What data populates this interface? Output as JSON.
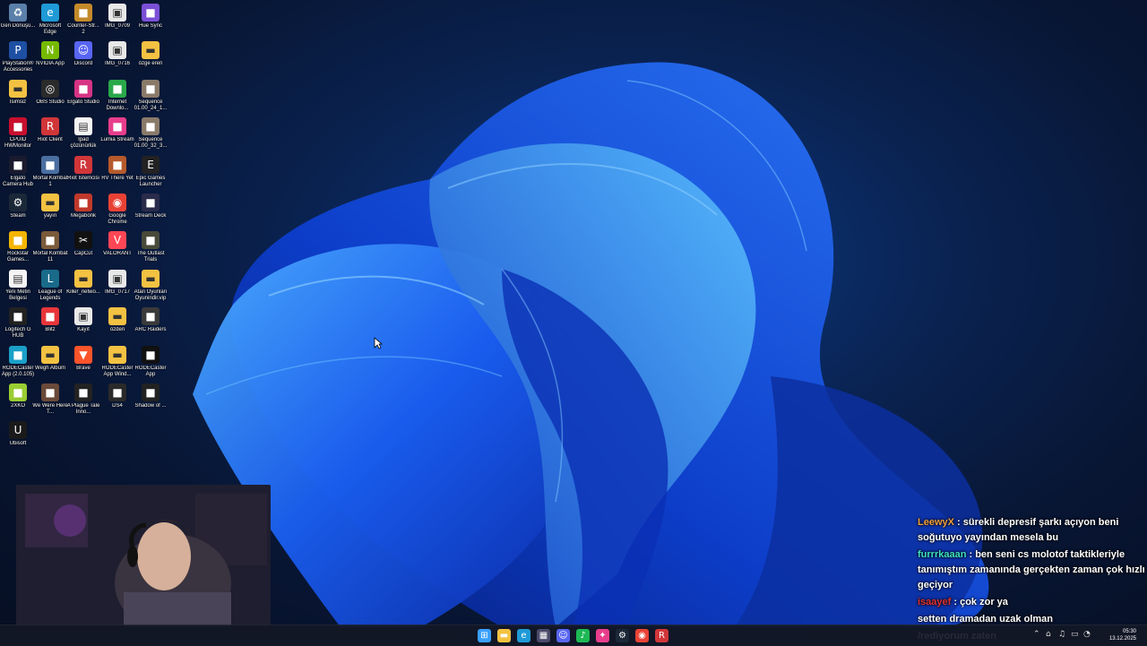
{
  "desktop_icons": [
    {
      "label": "Geri Dönüşü...",
      "icon": "recycle-bin-icon",
      "color": "#5a7fa8"
    },
    {
      "label": "Microsoft Edge",
      "icon": "edge-icon",
      "color": "#1f9ad6"
    },
    {
      "label": "Counter-Str... 2",
      "icon": "cs2-icon",
      "color": "#c48a2a"
    },
    {
      "label": "IMG_0709",
      "icon": "image-file-icon",
      "color": "#e8e8e8"
    },
    {
      "label": "Hue Sync",
      "icon": "hue-sync-icon",
      "color": "#7b4fd6"
    },
    {
      "label": "PlayStation® Accessories",
      "icon": "playstation-icon",
      "color": "#1d4fa3"
    },
    {
      "label": "NVIDIA App",
      "icon": "nvidia-icon",
      "color": "#76b900"
    },
    {
      "label": "Discord",
      "icon": "discord-icon",
      "color": "#5865f2"
    },
    {
      "label": "IMG_0716",
      "icon": "image-file-icon",
      "color": "#e8e8e8"
    },
    {
      "label": "özge eren",
      "icon": "folder-icon",
      "color": "#f3c242"
    },
    {
      "label": "İsimsiz",
      "icon": "folder-icon",
      "color": "#f3c242"
    },
    {
      "label": "OBS Studio",
      "icon": "obs-icon",
      "color": "#2b2b2b"
    },
    {
      "label": "Elgato Studio",
      "icon": "elgato-studio-icon",
      "color": "#d63384"
    },
    {
      "label": "Internet Downlo...",
      "icon": "idm-icon",
      "color": "#2aa84a"
    },
    {
      "label": "Sequence 01.00_24_1...",
      "icon": "video-thumbnail-icon",
      "color": "#8a7a6a"
    },
    {
      "label": "CPUID HWMonitor",
      "icon": "hwmonitor-icon",
      "color": "#c8102e"
    },
    {
      "label": "Riot Client",
      "icon": "riot-icon",
      "color": "#d13639"
    },
    {
      "label": "İpad çözünürlük",
      "icon": "text-file-icon",
      "color": "#f5f5f5"
    },
    {
      "label": "Lumia Stream",
      "icon": "lumia-icon",
      "color": "#e83e8c"
    },
    {
      "label": "Sequence 01.00_32_3...",
      "icon": "video-thumbnail-icon",
      "color": "#8a7a6a"
    },
    {
      "label": "Elgato Camera Hub",
      "icon": "camera-hub-icon",
      "color": "#1a1a2e"
    },
    {
      "label": "Mortal Kombat 1",
      "icon": "mk1-icon",
      "color": "#4a6ea0"
    },
    {
      "label": "Riot İstemcisi",
      "icon": "riot-icon",
      "color": "#d13639"
    },
    {
      "label": "RV There Yet",
      "icon": "rv-game-icon",
      "color": "#b55a2c"
    },
    {
      "label": "Epic Games Launcher",
      "icon": "epic-icon",
      "color": "#222"
    },
    {
      "label": "Steam",
      "icon": "steam-icon",
      "color": "#1b2838"
    },
    {
      "label": "yayın",
      "icon": "folder-icon",
      "color": "#f3c242"
    },
    {
      "label": "Megabonk",
      "icon": "megabonk-icon",
      "color": "#c0392b"
    },
    {
      "label": "Google Chrome",
      "icon": "chrome-icon",
      "color": "#e94235"
    },
    {
      "label": "Stream Deck",
      "icon": "stream-deck-icon",
      "color": "#2b2b4a"
    },
    {
      "label": "Rockstar Games...",
      "icon": "rockstar-icon",
      "color": "#f4b400"
    },
    {
      "label": "Mortal Kombat 11",
      "icon": "mk11-icon",
      "color": "#7a5a3a"
    },
    {
      "label": "CapCut",
      "icon": "capcut-icon",
      "color": "#111"
    },
    {
      "label": "VALORANT",
      "icon": "valorant-icon",
      "color": "#ff4655"
    },
    {
      "label": "The Outlast Trials",
      "icon": "outlast-icon",
      "color": "#4a4a3a"
    },
    {
      "label": "Yeni Metin Belgesi",
      "icon": "text-file-icon",
      "color": "#f5f5f5"
    },
    {
      "label": "League of Legends",
      "icon": "lol-icon",
      "color": "#1a6a8a"
    },
    {
      "label": "Killer_netwo...",
      "icon": "folder-icon",
      "color": "#f3c242"
    },
    {
      "label": "IMG_0717",
      "icon": "image-file-icon",
      "color": "#e8e8e8"
    },
    {
      "label": "Atari Oyunları Oyunindir.vip",
      "icon": "folder-icon",
      "color": "#f3c242"
    },
    {
      "label": "Logitech G HUB",
      "icon": "ghub-icon",
      "color": "#222"
    },
    {
      "label": "Blitz",
      "icon": "blitz-icon",
      "color": "#e8353a"
    },
    {
      "label": "Kayıt",
      "icon": "image-file-icon",
      "color": "#e8e8e8"
    },
    {
      "label": "özden",
      "icon": "folder-icon",
      "color": "#f3c242"
    },
    {
      "label": "ARC Raiders",
      "icon": "arc-raiders-icon",
      "color": "#3a3a3a"
    },
    {
      "label": "RODECaster App (2.0.105)",
      "icon": "rodecaster-icon",
      "color": "#1aa0c8"
    },
    {
      "label": "Wegh Albüm",
      "icon": "folder-icon",
      "color": "#f3c242"
    },
    {
      "label": "Brave",
      "icon": "brave-icon",
      "color": "#fb542b"
    },
    {
      "label": "RODECaster App Wind...",
      "icon": "folder-icon",
      "color": "#f3c242"
    },
    {
      "label": "RODECaster App",
      "icon": "rodecaster-icon",
      "color": "#111"
    },
    {
      "label": "2XKO",
      "icon": "2xko-icon",
      "color": "#9acd32"
    },
    {
      "label": "We Were Here T...",
      "icon": "we-were-here-icon",
      "color": "#6a4a3a"
    },
    {
      "label": "A Plague Tale Inno...",
      "icon": "plague-tale-icon",
      "color": "#222"
    },
    {
      "label": "DS4",
      "icon": "ds4-icon",
      "color": "#2a2a2a"
    },
    {
      "label": "Shadow of ...",
      "icon": "shadow-icon",
      "color": "#222"
    },
    {
      "label": "Ubisoft",
      "icon": "ubisoft-icon",
      "color": "#1a1a1a"
    }
  ],
  "chat": [
    {
      "user": "LeewyX",
      "user_color": "#f0a040",
      "text": " : sürekli depresif şarkı açıyon beni soğutuyo yayından mesela bu"
    },
    {
      "user": "furrrkaaan",
      "user_color": "#40e0c0",
      "text": " : ben seni cs molotof taktikleriyle tanımıştım zamanında gerçekten zaman çok hızlı geçiyor"
    },
    {
      "user": "isaayef",
      "user_color": "#e03030",
      "text": " : çok zor ya"
    },
    {
      "user": "",
      "user_color": "#ffffff",
      "text": "setten dramadan uzak olman"
    },
    {
      "user": "",
      "user_color": "#ffffff",
      "text": "/rediyorum zaten"
    }
  ],
  "taskbar": {
    "apps": [
      {
        "icon": "windows-start-icon",
        "color": "#3aa0ff"
      },
      {
        "icon": "file-explorer-icon",
        "color": "#f3c242"
      },
      {
        "icon": "edge-icon",
        "color": "#1f9ad6"
      },
      {
        "icon": "microsoft-store-icon",
        "color": "#4a4a6a"
      },
      {
        "icon": "discord-icon",
        "color": "#5865f2"
      },
      {
        "icon": "spotify-icon",
        "color": "#1db954"
      },
      {
        "icon": "lumia-icon",
        "color": "#e83e8c"
      },
      {
        "icon": "steam-icon",
        "color": "#1b2838"
      },
      {
        "icon": "chrome-icon",
        "color": "#e94235"
      },
      {
        "icon": "riot-icon",
        "color": "#d13639"
      }
    ],
    "tray_icons": [
      "chevron-up-icon",
      "network-icon",
      "volume-icon",
      "battery-icon",
      "notification-icon"
    ],
    "time": "05:30",
    "date": "13.12.2025"
  }
}
